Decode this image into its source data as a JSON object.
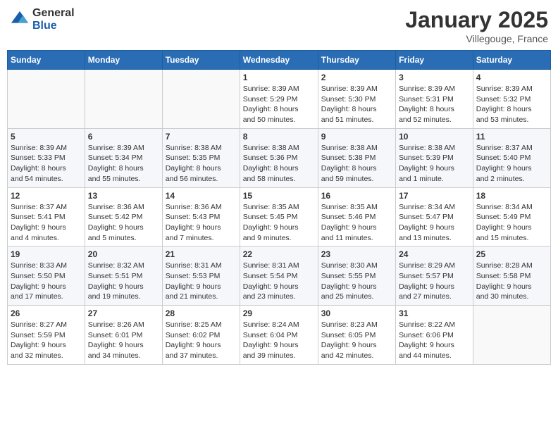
{
  "header": {
    "logo_general": "General",
    "logo_blue": "Blue",
    "title": "January 2025",
    "subtitle": "Villegouge, France"
  },
  "calendar": {
    "weekdays": [
      "Sunday",
      "Monday",
      "Tuesday",
      "Wednesday",
      "Thursday",
      "Friday",
      "Saturday"
    ],
    "weeks": [
      [
        {
          "day": "",
          "info": ""
        },
        {
          "day": "",
          "info": ""
        },
        {
          "day": "",
          "info": ""
        },
        {
          "day": "1",
          "info": "Sunrise: 8:39 AM\nSunset: 5:29 PM\nDaylight: 8 hours\nand 50 minutes."
        },
        {
          "day": "2",
          "info": "Sunrise: 8:39 AM\nSunset: 5:30 PM\nDaylight: 8 hours\nand 51 minutes."
        },
        {
          "day": "3",
          "info": "Sunrise: 8:39 AM\nSunset: 5:31 PM\nDaylight: 8 hours\nand 52 minutes."
        },
        {
          "day": "4",
          "info": "Sunrise: 8:39 AM\nSunset: 5:32 PM\nDaylight: 8 hours\nand 53 minutes."
        }
      ],
      [
        {
          "day": "5",
          "info": "Sunrise: 8:39 AM\nSunset: 5:33 PM\nDaylight: 8 hours\nand 54 minutes."
        },
        {
          "day": "6",
          "info": "Sunrise: 8:39 AM\nSunset: 5:34 PM\nDaylight: 8 hours\nand 55 minutes."
        },
        {
          "day": "7",
          "info": "Sunrise: 8:38 AM\nSunset: 5:35 PM\nDaylight: 8 hours\nand 56 minutes."
        },
        {
          "day": "8",
          "info": "Sunrise: 8:38 AM\nSunset: 5:36 PM\nDaylight: 8 hours\nand 58 minutes."
        },
        {
          "day": "9",
          "info": "Sunrise: 8:38 AM\nSunset: 5:38 PM\nDaylight: 8 hours\nand 59 minutes."
        },
        {
          "day": "10",
          "info": "Sunrise: 8:38 AM\nSunset: 5:39 PM\nDaylight: 9 hours\nand 1 minute."
        },
        {
          "day": "11",
          "info": "Sunrise: 8:37 AM\nSunset: 5:40 PM\nDaylight: 9 hours\nand 2 minutes."
        }
      ],
      [
        {
          "day": "12",
          "info": "Sunrise: 8:37 AM\nSunset: 5:41 PM\nDaylight: 9 hours\nand 4 minutes."
        },
        {
          "day": "13",
          "info": "Sunrise: 8:36 AM\nSunset: 5:42 PM\nDaylight: 9 hours\nand 5 minutes."
        },
        {
          "day": "14",
          "info": "Sunrise: 8:36 AM\nSunset: 5:43 PM\nDaylight: 9 hours\nand 7 minutes."
        },
        {
          "day": "15",
          "info": "Sunrise: 8:35 AM\nSunset: 5:45 PM\nDaylight: 9 hours\nand 9 minutes."
        },
        {
          "day": "16",
          "info": "Sunrise: 8:35 AM\nSunset: 5:46 PM\nDaylight: 9 hours\nand 11 minutes."
        },
        {
          "day": "17",
          "info": "Sunrise: 8:34 AM\nSunset: 5:47 PM\nDaylight: 9 hours\nand 13 minutes."
        },
        {
          "day": "18",
          "info": "Sunrise: 8:34 AM\nSunset: 5:49 PM\nDaylight: 9 hours\nand 15 minutes."
        }
      ],
      [
        {
          "day": "19",
          "info": "Sunrise: 8:33 AM\nSunset: 5:50 PM\nDaylight: 9 hours\nand 17 minutes."
        },
        {
          "day": "20",
          "info": "Sunrise: 8:32 AM\nSunset: 5:51 PM\nDaylight: 9 hours\nand 19 minutes."
        },
        {
          "day": "21",
          "info": "Sunrise: 8:31 AM\nSunset: 5:53 PM\nDaylight: 9 hours\nand 21 minutes."
        },
        {
          "day": "22",
          "info": "Sunrise: 8:31 AM\nSunset: 5:54 PM\nDaylight: 9 hours\nand 23 minutes."
        },
        {
          "day": "23",
          "info": "Sunrise: 8:30 AM\nSunset: 5:55 PM\nDaylight: 9 hours\nand 25 minutes."
        },
        {
          "day": "24",
          "info": "Sunrise: 8:29 AM\nSunset: 5:57 PM\nDaylight: 9 hours\nand 27 minutes."
        },
        {
          "day": "25",
          "info": "Sunrise: 8:28 AM\nSunset: 5:58 PM\nDaylight: 9 hours\nand 30 minutes."
        }
      ],
      [
        {
          "day": "26",
          "info": "Sunrise: 8:27 AM\nSunset: 5:59 PM\nDaylight: 9 hours\nand 32 minutes."
        },
        {
          "day": "27",
          "info": "Sunrise: 8:26 AM\nSunset: 6:01 PM\nDaylight: 9 hours\nand 34 minutes."
        },
        {
          "day": "28",
          "info": "Sunrise: 8:25 AM\nSunset: 6:02 PM\nDaylight: 9 hours\nand 37 minutes."
        },
        {
          "day": "29",
          "info": "Sunrise: 8:24 AM\nSunset: 6:04 PM\nDaylight: 9 hours\nand 39 minutes."
        },
        {
          "day": "30",
          "info": "Sunrise: 8:23 AM\nSunset: 6:05 PM\nDaylight: 9 hours\nand 42 minutes."
        },
        {
          "day": "31",
          "info": "Sunrise: 8:22 AM\nSunset: 6:06 PM\nDaylight: 9 hours\nand 44 minutes."
        },
        {
          "day": "",
          "info": ""
        }
      ]
    ]
  }
}
